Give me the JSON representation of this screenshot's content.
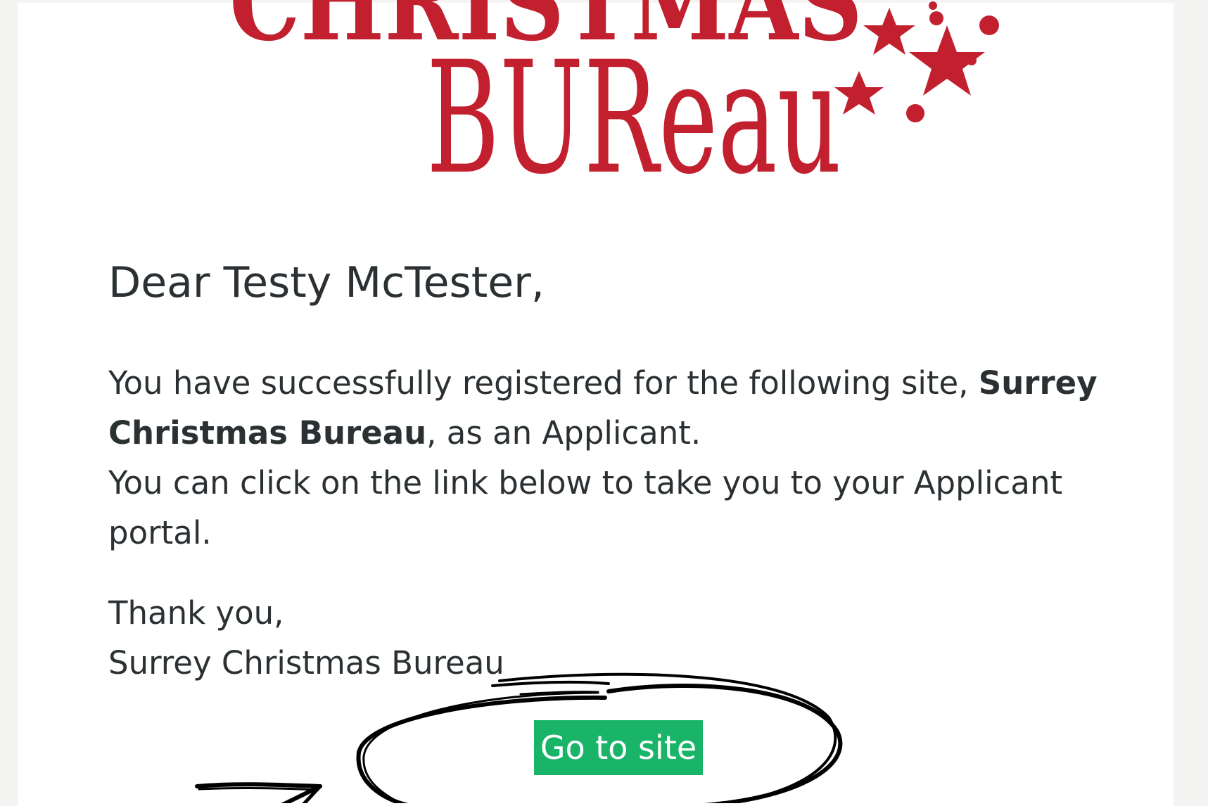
{
  "logo": {
    "line1": "CHRISTMAS",
    "line2": "BUReau"
  },
  "email": {
    "greeting": "Dear Testy McTester,",
    "paragraph": {
      "line1_text": "You have successfully registered for the following site, ",
      "line1_bold": "Surrey",
      "line2_bold": "Christmas Bureau",
      "line2_text": ", as an Applicant.",
      "line3": "You can click on the link below to take you to your Applicant",
      "line4": "portal."
    },
    "signoff": {
      "thanks": "Thank you,",
      "sender": "Surrey Christmas Bureau"
    },
    "button_label": "Go to site"
  },
  "colors": {
    "brand_red": "#c2202e",
    "button_green": "#19b468",
    "text": "#2b3033",
    "annotation_ink": "#000000"
  },
  "icons": {
    "logo_stars": "star-cluster-icon",
    "annotation_circle": "hand-drawn-circle",
    "annotation_arrow": "hand-drawn-arrow-icon"
  }
}
